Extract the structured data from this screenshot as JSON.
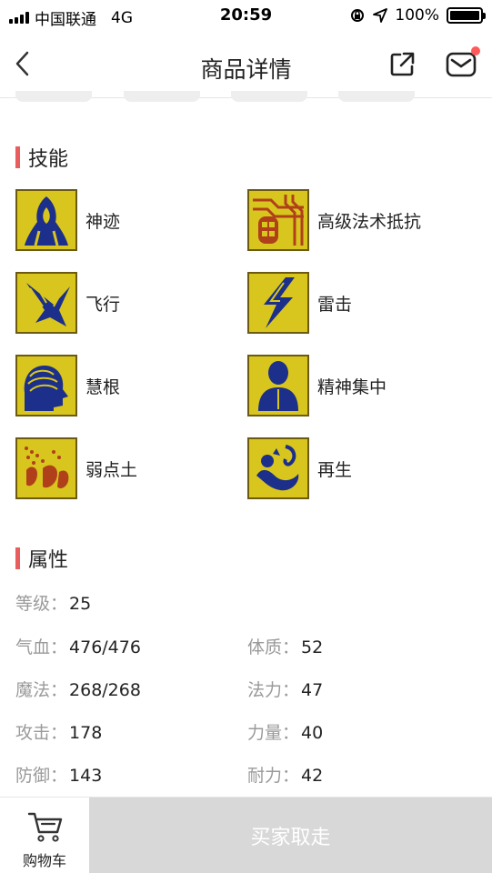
{
  "status_bar": {
    "carrier": "中国联通",
    "network": "4G",
    "time": "20:59",
    "battery": "100%"
  },
  "nav": {
    "title": "商品详情",
    "has_notification": true,
    "notification_color": "#ff5a5a"
  },
  "skills": {
    "title": "技能",
    "items": [
      {
        "name": "神迹",
        "icon": "hooded-figure-icon"
      },
      {
        "name": "高级法术抵抗",
        "icon": "circuit-shield-icon"
      },
      {
        "name": "飞行",
        "icon": "wing-icon"
      },
      {
        "name": "雷击",
        "icon": "lightning-icon"
      },
      {
        "name": "慧根",
        "icon": "wise-head-icon"
      },
      {
        "name": "精神集中",
        "icon": "meditating-figure-icon"
      },
      {
        "name": "弱点土",
        "icon": "earth-weakness-icon"
      },
      {
        "name": "再生",
        "icon": "regeneration-icon"
      }
    ]
  },
  "attributes": {
    "title": "属性",
    "items": [
      {
        "label": "等级：",
        "value": "25"
      },
      {
        "label": "气血：",
        "value": "476/476"
      },
      {
        "label": "体质：",
        "value": "52"
      },
      {
        "label": "魔法：",
        "value": "268/268"
      },
      {
        "label": "法力：",
        "value": "47"
      },
      {
        "label": "攻击：",
        "value": "178"
      },
      {
        "label": "力量：",
        "value": "40"
      },
      {
        "label": "防御：",
        "value": "143"
      },
      {
        "label": "耐力：",
        "value": "42"
      }
    ]
  },
  "bottom": {
    "cart_label": "购物车",
    "buy_label": "买家取走"
  },
  "colors": {
    "accent": "#e85d5d",
    "icon_background": "#d7c51c",
    "button_disabled": "#d8d8d8"
  }
}
